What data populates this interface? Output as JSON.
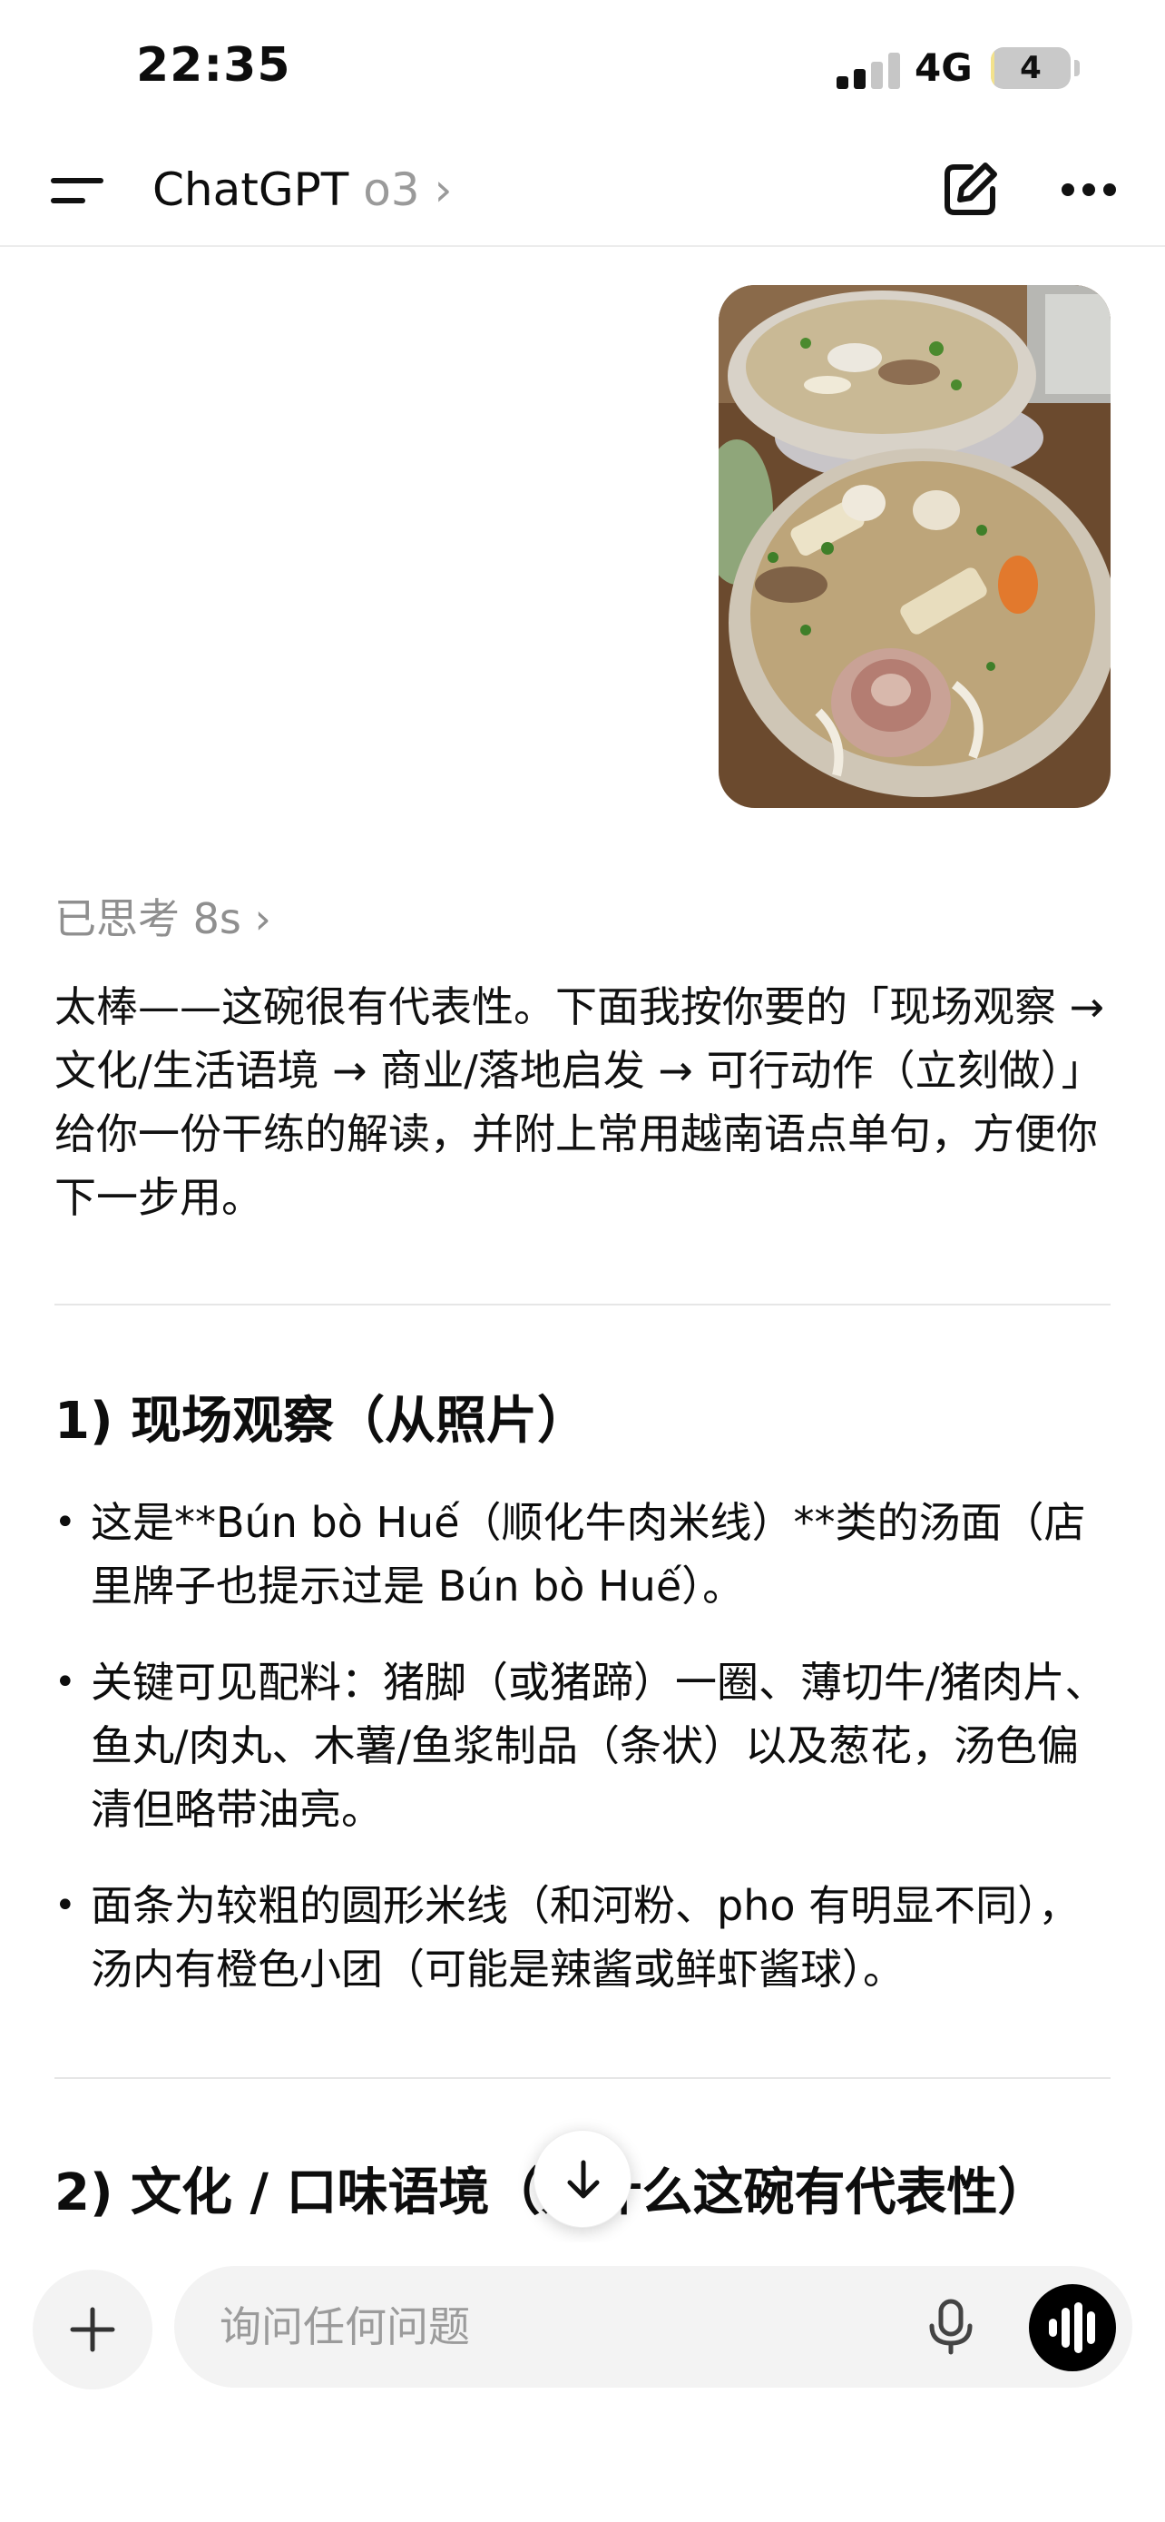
{
  "status_bar": {
    "time": "22:35",
    "network": "4G",
    "battery_level": "4",
    "battery_fraction": 0.04
  },
  "nav": {
    "app_name": "ChatGPT",
    "model": "o3",
    "chevron": "›",
    "icons": [
      "menu-icon",
      "edit-icon",
      "more-icon"
    ]
  },
  "message": {
    "attachment": "photo of Bún bò Huế noodle soup bowls",
    "thinking": "已思考 8s ›",
    "intro": "太棒——这碗很有代表性。下面我按你要的「现场观察 → 文化/生活语境 → 商业/落地启发 → 可行动作（立刻做）」给你一份干练的解读，并附上常用越南语点单句，方便你下一步用。",
    "section1_heading": "1) 现场观察（从照片）",
    "bullets": [
      "这是**Bún bò Huế（顺化牛肉米线）**类的汤面（店里牌子也提示过是 Bún bò Huế）。",
      "关键可见配料：猪脚（或猪蹄）一圈、薄切牛/猪肉片、鱼丸/肉丸、木薯/鱼浆制品（条状）以及葱花，汤色偏清但略带油亮。",
      "面条为较粗的圆形米线（和河粉、pho 有明显不同），汤内有橙色小团（可能是辣酱或鲜虾酱球）。"
    ],
    "section2_heading": "2) 文化 / 口味语境（为什么这碗有代表性）"
  },
  "composer": {
    "placeholder": "询问任何问题",
    "icons": [
      "plus-icon",
      "mic-icon",
      "voice-mode-icon",
      "arrow-down-icon"
    ]
  },
  "colors": {
    "text": "#0d0d0d",
    "muted": "#9a9a9a",
    "pill": "#f3f3f3",
    "battery": "#f3e28c"
  }
}
